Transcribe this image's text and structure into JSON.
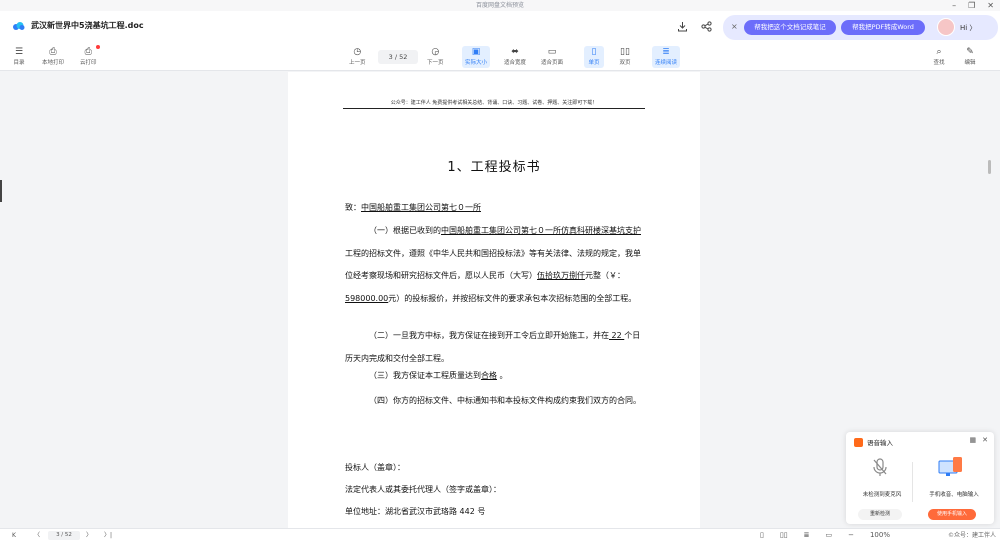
{
  "window": {
    "title": "百度网盘文档预览",
    "controls": [
      "–",
      "❐",
      "✕"
    ]
  },
  "header": {
    "doc_title": "武汉新世界中5浇基坑工程.doc",
    "download_icon": "download-icon",
    "share_icon": "share-icon",
    "ai": {
      "close": "×",
      "btn1": "帮我把这个文档记成笔记",
      "btn2": "帮我把PDF转成Word",
      "greeting": "Hi 〉"
    }
  },
  "toolbar": {
    "catalog": "目录",
    "local_print": "本地打印",
    "cloud_print": "云打印",
    "prev": "上一页",
    "page_indicator": "3  / 52",
    "next": "下一页",
    "actual_size": "实际大小",
    "fit_width": "适合宽度",
    "fit_page": "适合页面",
    "single": "单页",
    "double": "双页",
    "continuous": "连续阅读",
    "search": "查找",
    "edit": "编辑"
  },
  "document": {
    "header_line": "公众号：建工伴人 免费提供考试相关总结、背诵、口诀、习题、试卷、押题、关注即可下载！",
    "title": "1、工程投标书",
    "to_prefix": "致：",
    "to_company": "中国船舶重工集团公司第七０一所",
    "p1_a": "（一）根据已收到的",
    "p1_b": "中国船舶重工集团公司第七０一所仿真科研楼",
    "p1_c": "深基坑支护",
    "p1_d": "工程的招标文件，遵照《中华人民共和国招投标法》等有关",
    "p1_e": "法律、法规的规定，我单位经考察现场和研究招标文件后，愿以人民币",
    "p1_f": "（大写）",
    "p1_g": "伍拾玖万捌仟",
    "p1_h": "元整（￥：",
    "p1_i": "598000.00",
    "p1_j": "元）的投标报价，并按招",
    "p1_k": "标文件的要求承包本次招标范围的全部工程。",
    "p2_a": "（二）一旦我方中标，我方保证在接到开工令后立即开始施工，并",
    "p2_b": "在",
    "p2_c": " 22 ",
    "p2_d": "个日历天内完成和交付全部工程。",
    "p3_a": "（三）我方保证本工程质量达到",
    "p3_b": "合格",
    "p3_c": " 。",
    "p4_a": "（四）你方的招标文件、中标通知书和本投标文件构成约束我们双",
    "p4_b": "方的合同。",
    "bidder": "投标人（盖章）：",
    "legal_rep": "法定代表人或其委托代理人（签字或盖章）：",
    "address": "单位地址：湖北省武汉市武珞路 442 号"
  },
  "voice_popup": {
    "title": "语音输入",
    "mic_status": "未检测到麦克风",
    "pc_text": "手机收音、电脑输入",
    "btn_redetect": "重新检测",
    "btn_use_phone": "使用手机输入"
  },
  "bottombar": {
    "first": "K",
    "prev": "〈",
    "page": "3  / 52",
    "next": "〉",
    "last": "〉|",
    "zoom": "100%",
    "watermark": "©众号：建工伴人"
  }
}
